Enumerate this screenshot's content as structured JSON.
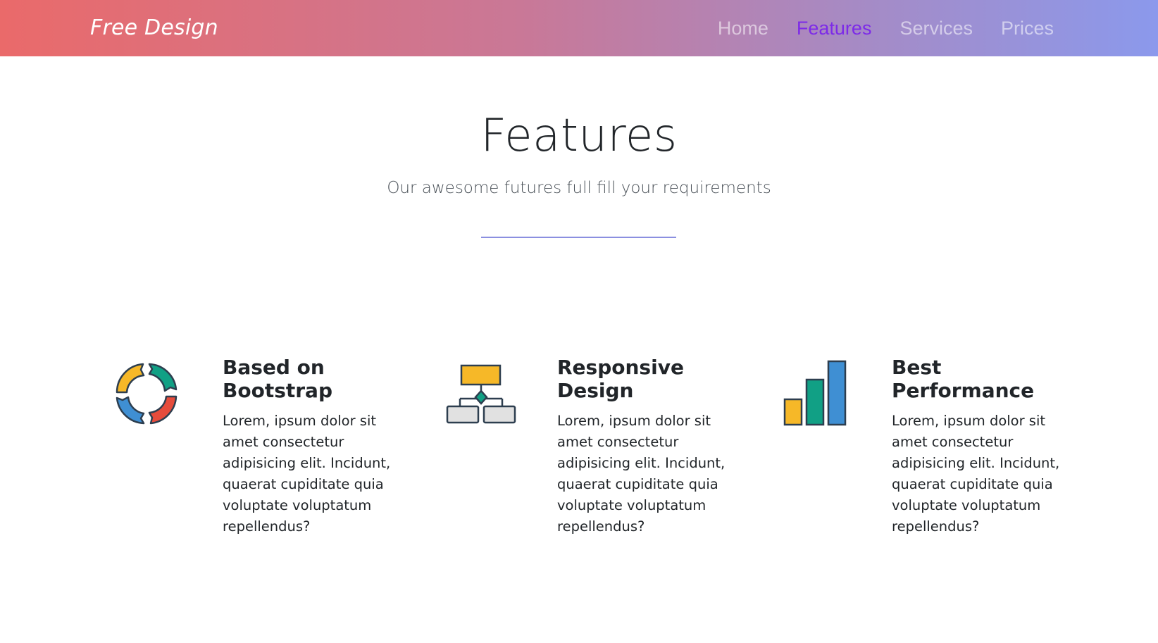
{
  "navbar": {
    "brand": "Free Design",
    "links": [
      {
        "label": "Home",
        "active": false
      },
      {
        "label": "Features",
        "active": true
      },
      {
        "label": "Services",
        "active": false
      },
      {
        "label": "Prices",
        "active": false
      }
    ]
  },
  "section": {
    "title": "Features",
    "subtitle": "Our awesome futures full fill your requirements"
  },
  "features": [
    {
      "icon": "cycle-arrows-icon",
      "title": "Based on Bootstrap",
      "description": "Lorem, ipsum dolor sit amet consectetur adipisicing elit. Incidunt, quaerat cupiditate quia voluptate voluptatum repellendus?"
    },
    {
      "icon": "flowchart-icon",
      "title": "Responsive Design",
      "description": "Lorem, ipsum dolor sit amet consectetur adipisicing elit. Incidunt, quaerat cupiditate quia voluptate voluptatum repellendus?"
    },
    {
      "icon": "bar-chart-icon",
      "title": "Best Performance",
      "description": "Lorem, ipsum dolor sit amet consectetur adipisicing elit. Incidunt, quaerat cupiditate quia voluptate voluptatum repellendus?"
    }
  ],
  "colors": {
    "accent": "#7d2ae8",
    "gradient_start": "#ea6a6a",
    "gradient_end": "#8b99ec",
    "divider": "#8b8fe0",
    "icon_yellow": "#f6b828",
    "icon_green": "#11a085",
    "icon_red": "#e64c3c",
    "icon_blue": "#3f8fd3",
    "icon_grey": "#e1e1e1",
    "icon_outline": "#2d3e4f"
  }
}
